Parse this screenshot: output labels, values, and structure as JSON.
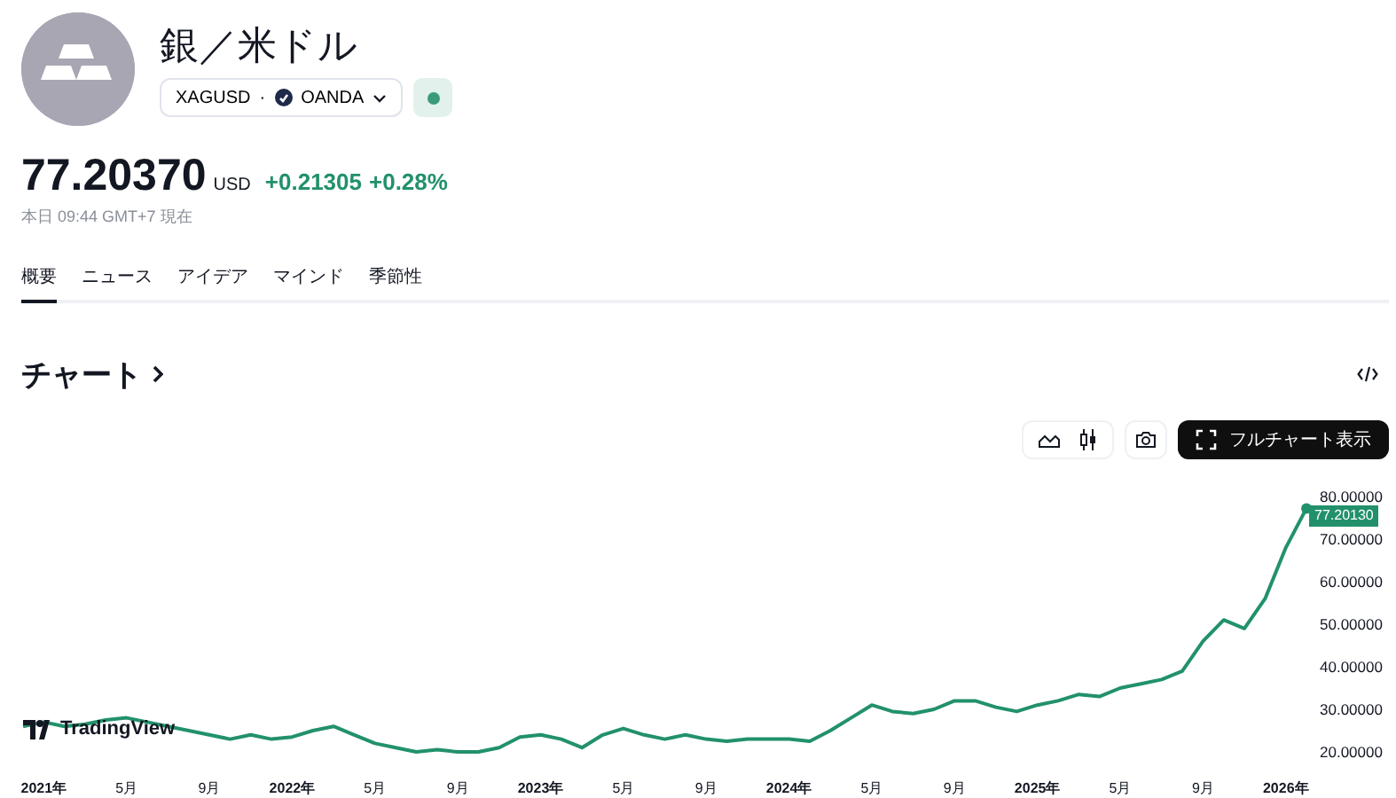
{
  "instrument": {
    "title": "銀／米ドル",
    "symbol": "XAGUSD",
    "separator": "·",
    "exchange": "OANDA",
    "market_open": true
  },
  "quote": {
    "price": "77.20370",
    "currency": "USD",
    "change": "+0.21305",
    "change_percent": "+0.28%",
    "timestamp": "本日 09:44 GMT+7 現在"
  },
  "tabs": [
    {
      "label": "概要",
      "selected": true
    },
    {
      "label": "ニュース",
      "selected": false
    },
    {
      "label": "アイデア",
      "selected": false
    },
    {
      "label": "マインド",
      "selected": false
    },
    {
      "label": "季節性",
      "selected": false
    }
  ],
  "chart_section": {
    "title": "チャート",
    "fullscreen_button": "フルチャート表示",
    "logo": "TradingView",
    "last_price_label": "77.20130",
    "chart_data": {
      "type": "line",
      "categories": [
        null,
        "2021年",
        null,
        null,
        null,
        "5月",
        null,
        null,
        null,
        "9月",
        null,
        null,
        null,
        "2022年",
        null,
        null,
        null,
        "5月",
        null,
        null,
        null,
        "9月",
        null,
        null,
        null,
        "2023年",
        null,
        null,
        null,
        "5月",
        null,
        null,
        null,
        "9月",
        null,
        null,
        null,
        "2024年",
        null,
        null,
        null,
        "5月",
        null,
        null,
        null,
        "9月",
        null,
        null,
        null,
        "2025年",
        null,
        null,
        null,
        "5月",
        null,
        null,
        null,
        "9月",
        null,
        null,
        null,
        "2026年",
        null
      ],
      "series": [
        {
          "color": "#22916b",
          "values": [
            26,
            27,
            26,
            26.5,
            27.5,
            28,
            27,
            26,
            25,
            24,
            23,
            24,
            23,
            23.5,
            25,
            26,
            24,
            22,
            21,
            20,
            20.5,
            20,
            20,
            21,
            23.5,
            24,
            23,
            21,
            24,
            25.5,
            24,
            23,
            24,
            23,
            22.5,
            23,
            23,
            23,
            22.5,
            25,
            28,
            31,
            29.5,
            29,
            30,
            32,
            32,
            30.5,
            29.5,
            31,
            32,
            33.5,
            33,
            35,
            36,
            37,
            39,
            46,
            51,
            49,
            56,
            68,
            77.2
          ]
        }
      ],
      "ylim": [
        20,
        80
      ],
      "yticks": [
        {
          "value": 20,
          "label": "20.00000"
        },
        {
          "value": 30,
          "label": "30.00000"
        },
        {
          "value": 40,
          "label": "40.00000"
        },
        {
          "value": 50,
          "label": "50.00000"
        },
        {
          "value": 60,
          "label": "60.00000"
        },
        {
          "value": 70,
          "label": "70.00000"
        },
        {
          "value": 80,
          "label": "80.00000"
        }
      ]
    }
  }
}
